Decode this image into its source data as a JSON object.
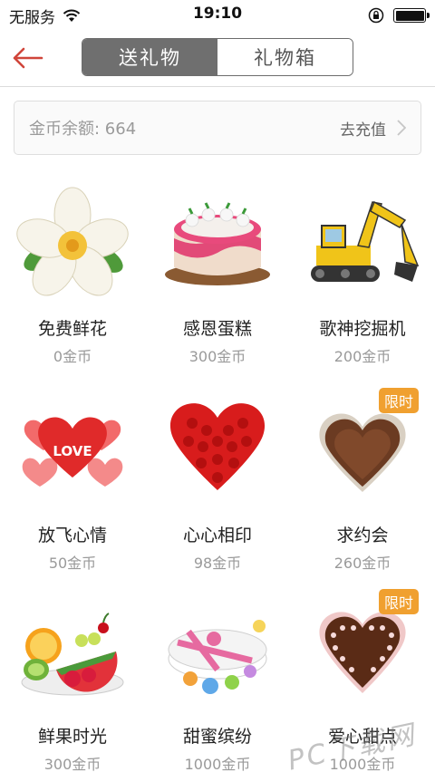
{
  "status_bar": {
    "carrier": "无服务",
    "time": "19:10"
  },
  "nav": {
    "tabs": [
      {
        "label": "送礼物",
        "active": true
      },
      {
        "label": "礼物箱",
        "active": false
      }
    ]
  },
  "balance": {
    "label": "金币余额: 664",
    "action": "去充值"
  },
  "gifts": [
    {
      "name": "免费鲜花",
      "price": "0金币",
      "icon": "flower-icon",
      "badge": ""
    },
    {
      "name": "感恩蛋糕",
      "price": "300金币",
      "icon": "cake-icon",
      "badge": ""
    },
    {
      "name": "歌神挖掘机",
      "price": "200金币",
      "icon": "excavator-icon",
      "badge": ""
    },
    {
      "name": "放飞心情",
      "price": "50金币",
      "icon": "heart-balloons-icon",
      "badge": ""
    },
    {
      "name": "心心相印",
      "price": "98金币",
      "icon": "rose-heart-icon",
      "badge": ""
    },
    {
      "name": "求约会",
      "price": "260金币",
      "icon": "chocolate-icon",
      "badge": "限时"
    },
    {
      "name": "鲜果时光",
      "price": "300金币",
      "icon": "fruit-platter-icon",
      "badge": ""
    },
    {
      "name": "甜蜜缤纷",
      "price": "1000金币",
      "icon": "candy-box-icon",
      "badge": ""
    },
    {
      "name": "爱心甜点",
      "price": "1000金币",
      "icon": "heart-cake-icon",
      "badge": "限时"
    }
  ],
  "watermark": "PC下载网",
  "colors": {
    "accent_red": "#d0453a",
    "segment_active": "#6f6f6f",
    "badge": "#f0a030"
  }
}
